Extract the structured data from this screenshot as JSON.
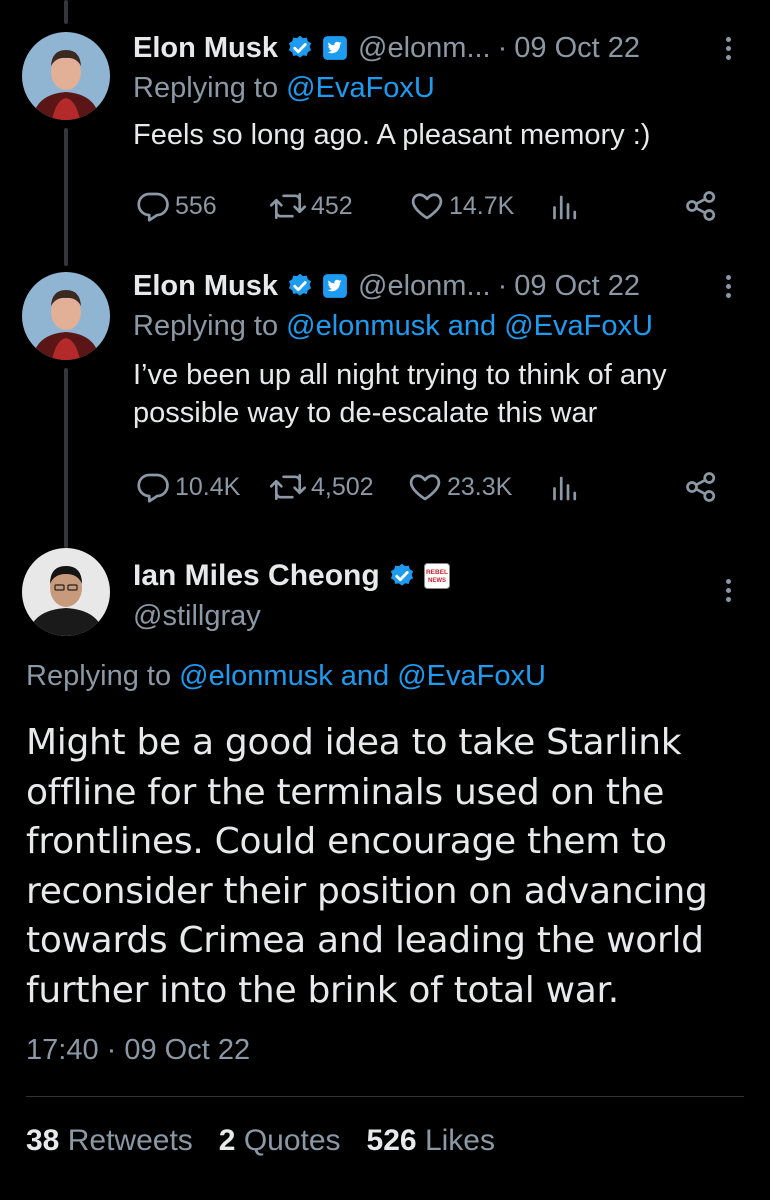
{
  "tweets": [
    {
      "name": "Elon Musk",
      "handle": "@elonm...",
      "date": "09 Oct 22",
      "replying_prefix": "Replying to ",
      "replying_links": "@EvaFoxU",
      "text": "Feels so long ago. A pleasant memory :)",
      "replies": "556",
      "retweets": "452",
      "likes": "14.7K"
    },
    {
      "name": "Elon Musk",
      "handle": "@elonm...",
      "date": "09 Oct 22",
      "replying_prefix": "Replying to ",
      "replying_links": "@elonmusk and @EvaFoxU",
      "text": "I’ve been up all night trying to think of any possible way to de-escalate this war",
      "replies": "10.4K",
      "retweets": "4,502",
      "likes": "23.3K"
    }
  ],
  "main": {
    "name": "Ian Miles Cheong",
    "handle": "@stillgray",
    "badge_text": "REBEL NEWS",
    "replying_prefix": "Replying to ",
    "replying_links": "@elonmusk and @EvaFoxU",
    "text": "Might be a good idea to take Starlink offline for the terminals used on the frontlines. Could encourage them to reconsider their position on advancing towards Crimea and leading the world further into the brink of total war.",
    "time": "17:40 · 09 Oct 22",
    "stats": {
      "retweets_count": "38",
      "retweets_label": "Retweets",
      "quotes_count": "2",
      "quotes_label": "Quotes",
      "likes_count": "526",
      "likes_label": "Likes"
    }
  },
  "colors": {
    "background": "#000000",
    "text": "#e7e9ea",
    "muted": "#8b98a5",
    "link": "#1d9bf0",
    "verified": "#1d9bf0"
  },
  "icons": [
    "reply-icon",
    "retweet-icon",
    "like-icon",
    "views-icon",
    "share-icon",
    "verified-badge-icon",
    "more-icon"
  ]
}
